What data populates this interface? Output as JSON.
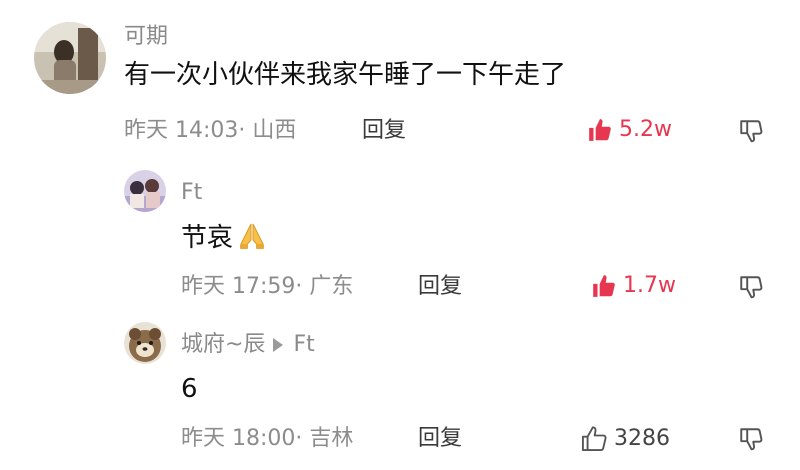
{
  "colors": {
    "like_active": "#e7364f",
    "meta_gray": "#8c8c8c",
    "text": "#111111"
  },
  "comments": [
    {
      "username": "可期",
      "content": "有一次小伙伴来我家午睡了一下午走了",
      "meta": "昨天 14:03· 山西",
      "reply_label": "回复",
      "likes": "5.2w",
      "liked_icon": "thumbs-up-filled-icon",
      "dislike_icon": "thumbs-down-outline-icon"
    },
    {
      "username": "Ft",
      "content": "节哀",
      "content_emoji": "folded-hands-emoji",
      "meta": "昨天 17:59· 广东",
      "reply_label": "回复",
      "likes": "1.7w",
      "liked_icon": "thumbs-up-filled-icon",
      "dislike_icon": "thumbs-down-outline-icon"
    },
    {
      "username": "城府~辰",
      "reply_to_arrow_icon": "play-arrow-icon",
      "reply_to": "Ft",
      "content": "6",
      "meta": "昨天 18:00· 吉林",
      "reply_label": "回复",
      "likes": "3286",
      "liked_icon": "thumbs-up-outline-icon",
      "dislike_icon": "thumbs-down-outline-icon"
    }
  ]
}
